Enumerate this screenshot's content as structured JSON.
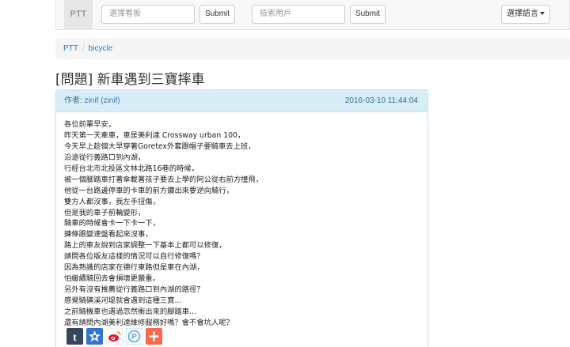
{
  "navbar": {
    "brand": "PTT",
    "board_search_placeholder": "選擇看板",
    "board_submit": "Submit",
    "user_search_placeholder": "檢索用戶",
    "user_submit": "Submit",
    "language_button": "選擇語言"
  },
  "breadcrumb": {
    "home": "PTT",
    "board": "bicycle"
  },
  "post": {
    "title": "[問題] 新車遇到三寶摔車",
    "author_label": "作者:",
    "author": "zinif (zinif)",
    "date": "2016-03-10 11:44:04",
    "lines": [
      "各位前輩早安，",
      "昨天第一天牽車，車是美利達 Crossway urban 100，",
      "今天早上趁個大早穿著Goretex外套跟帽子要騎車去上班，",
      "沿途從行義路口到內湖，",
      "行經台北市北投區文林北路16巷的時候，",
      "被一個腳踏車打著傘載著孩子要去上學的阿公從右前方撞飛，",
      "他從一台路邊停車的卡車的前方鑽出來要逆向騎行，",
      "雙方人都沒事，我左手扭傷，",
      "但是我的車子前輪變形，",
      "騎車的時候會卡一下卡一下，",
      "鍊條跟變速盤看起來沒事，",
      "路上的車友說到店家調整一下基本上都可以修復，",
      "請問各位版友這樣的情況可以自行修復嗎？",
      "因為熟識的店家在德行東路但是車在內湖，",
      "怕繼續騎回去會損壞更嚴重。",
      "另外有沒有推薦從行義路口到內湖的路徑？",
      "感覺騎磺溪河堤就會遇到這種三寶...",
      "之前騎機車也遇過忽然衝出來的腳踏車...",
      "還有請問內湖美利達維修服務好嗎？會不會坑人呢？"
    ]
  },
  "share": {
    "icons": [
      "tumblr-icon",
      "delicious-icon",
      "weibo-icon",
      "plurk-icon",
      "addthis-icon"
    ],
    "colors": [
      "#35465c",
      "#3274d1",
      "#e6162d",
      "#4da6e0",
      "#f8694d"
    ]
  }
}
